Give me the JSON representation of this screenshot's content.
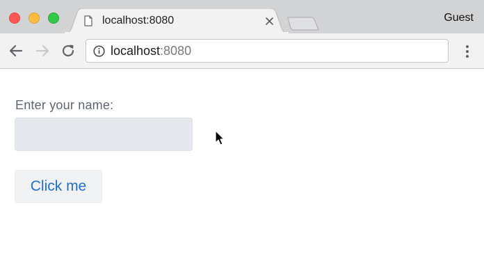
{
  "browser": {
    "tab": {
      "title": "localhost:8080",
      "page_icon": "page-icon",
      "close_icon": "close-icon"
    },
    "profile_label": "Guest",
    "window_controls": {
      "close_color": "#fc5753",
      "minimize_color": "#fdbc40",
      "maximize_color": "#34c84a"
    }
  },
  "toolbar": {
    "back_icon": "arrow-left-icon",
    "forward_icon": "arrow-right-icon",
    "reload_icon": "reload-icon",
    "menu_icon": "kebab-menu-icon",
    "address": {
      "site_info_icon": "info-icon",
      "host": "localhost",
      "port": ":8080"
    }
  },
  "page": {
    "name_label": "Enter your name:",
    "name_input": {
      "value": "",
      "placeholder": ""
    },
    "button_label": "Click me",
    "accent_color": "#1f6fd1"
  },
  "cursor": "arrow-cursor-icon"
}
